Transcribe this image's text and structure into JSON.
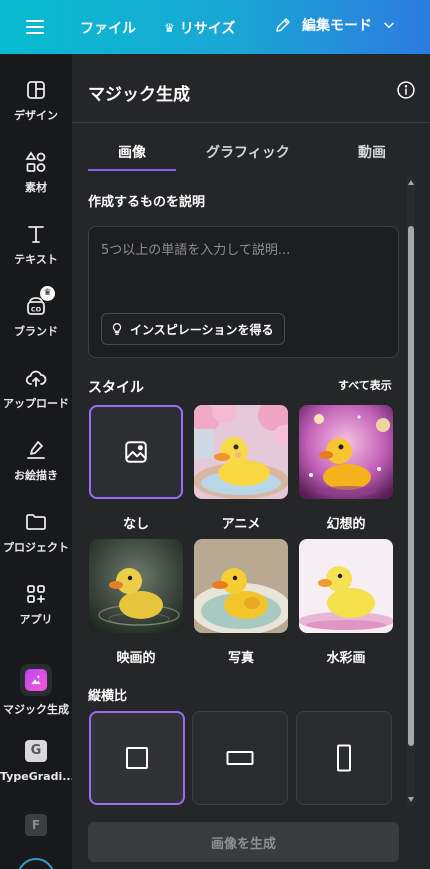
{
  "topbar": {
    "file_label": "ファイル",
    "resize_label": "リサイズ",
    "edit_mode_label": "編集モード"
  },
  "rail": {
    "items": [
      {
        "label": "デザイン",
        "icon": "layout-icon"
      },
      {
        "label": "素材",
        "icon": "shapes-icon"
      },
      {
        "label": "テキスト",
        "icon": "text-icon"
      },
      {
        "label": "ブランド",
        "icon": "brand-icon"
      },
      {
        "label": "アップロード",
        "icon": "upload-cloud-icon"
      },
      {
        "label": "お絵描き",
        "icon": "draw-icon"
      },
      {
        "label": "プロジェクト",
        "icon": "folder-icon"
      },
      {
        "label": "アプリ",
        "icon": "apps-icon"
      },
      {
        "label": "マジック生成",
        "icon": "magic-media-icon"
      },
      {
        "label": "TypeGradi...",
        "icon": "typegradient-app-icon"
      }
    ]
  },
  "panel": {
    "title": "マジック生成",
    "tabs": [
      {
        "label": "画像",
        "active": true
      },
      {
        "label": "グラフィック",
        "active": false
      },
      {
        "label": "動画",
        "active": false
      }
    ],
    "describe_label": "作成するものを説明",
    "prompt_placeholder": "5つ以上の単語を入力して説明...",
    "inspiration_label": "インスピレーションを得る",
    "style_label": "スタイル",
    "see_all_label": "すべて表示",
    "styles": [
      {
        "name": "なし",
        "selected": true
      },
      {
        "name": "アニメ",
        "selected": false
      },
      {
        "name": "幻想的",
        "selected": false
      },
      {
        "name": "映画的",
        "selected": false
      },
      {
        "name": "写真",
        "selected": false
      },
      {
        "name": "水彩画",
        "selected": false
      }
    ],
    "aspect_label": "縦横比",
    "aspect_ratios": [
      {
        "shape": "square",
        "selected": true
      },
      {
        "shape": "landscape",
        "selected": false
      },
      {
        "shape": "portrait",
        "selected": false
      }
    ],
    "generate_label": "画像を生成"
  },
  "colors": {
    "accent": "#8b5cf6",
    "topbar_start": "#08bcd0",
    "topbar_end": "#2c7be0",
    "panel_bg": "#252627",
    "rail_bg": "#18191b"
  }
}
